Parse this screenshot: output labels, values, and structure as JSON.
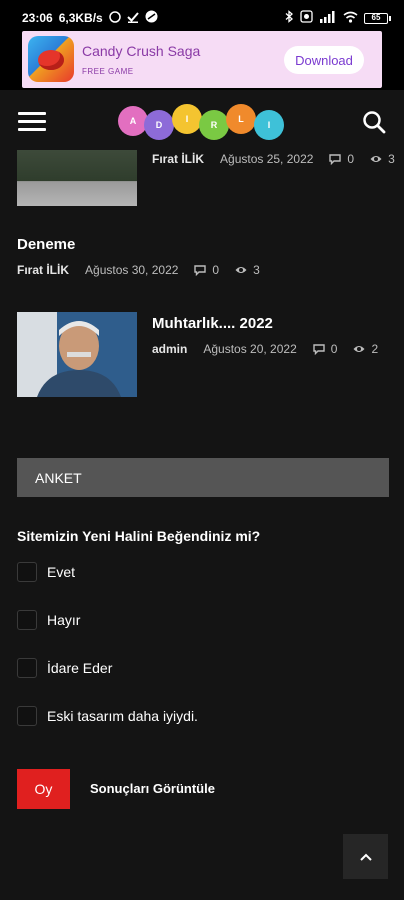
{
  "status": {
    "time": "23:06",
    "speed": "6,3KB/s",
    "battery": "65"
  },
  "ad": {
    "title": "Candy Crush Saga",
    "subtitle": "FREE GAME",
    "button": "Download"
  },
  "header": {
    "logo_letters": [
      "A",
      "D",
      "I",
      "R",
      "L",
      "I"
    ]
  },
  "posts": [
    {
      "title": "",
      "author": "Fırat İLİK",
      "date": "Ağustos 25, 2022",
      "comments": "0",
      "views": "3"
    },
    {
      "title": "Deneme",
      "author": "Fırat İLİK",
      "date": "Ağustos 30, 2022",
      "comments": "0",
      "views": "3"
    },
    {
      "title": "Muhtarlık.... 2022",
      "author": "admin",
      "date": "Ağustos 20, 2022",
      "comments": "0",
      "views": "2"
    }
  ],
  "poll": {
    "heading": "ANKET",
    "question": "Sitemizin Yeni Halini Beğendiniz mi?",
    "options": [
      "Evet",
      "Hayır",
      "İdare Eder",
      "Eski tasarım daha iyiydi."
    ],
    "vote_button": "Oy",
    "results_link": "Sonuçları Görüntüle"
  },
  "colors": {
    "background": "#141414",
    "accent_red": "#e0201f",
    "poll_header": "#555555"
  }
}
